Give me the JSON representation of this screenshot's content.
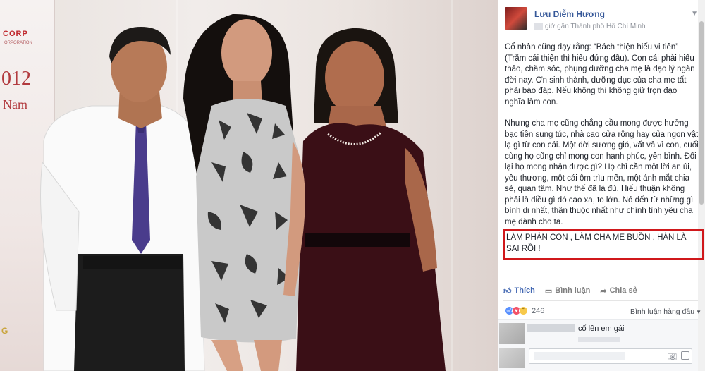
{
  "photo": {
    "banner_corp": "CORP",
    "banner_sub": "ORPORATION",
    "banner_year": "012",
    "banner_name": "Nam",
    "banner_logo": "G"
  },
  "post": {
    "author": "Lưu Diễm Hương",
    "meta": "giờ gần Thành phố Hồ Chí Minh",
    "paragraph1": "Cổ nhân cũng dạy rằng: “Bách thiện hiếu vi tiên” (Trăm cái thiện thì hiếu đứng đầu). Con cái phải hiếu thảo, chăm sóc, phụng dưỡng cha mẹ là đạo lý ngàn đời nay. Ơn sinh thành, dưỡng dục của cha mẹ tất phải báo đáp. Nếu không thì không giữ trọn đạo nghĩa làm con.",
    "paragraph2": "Nhưng cha mẹ cũng chẳng cầu mong được hưởng bạc tiền sung túc, nhà cao cửa rộng hay của ngon vật lạ gì từ con cái. Một đời sương gió, vất vả vì con, cuối cùng họ cũng chỉ mong con hạnh phúc, yên bình. Đổi lại họ mong nhận được gì? Họ chỉ cần một lời an ủi, yêu thương, một cái ôm trìu mến, một ánh mắt chia sẻ, quan tâm. Như thế đã là đủ. Hiếu thuận không phải là điều gì đó cao xa, to lớn. Nó đến từ những gì bình dị nhất, thân thuộc nhất như chính tình yêu cha mẹ dành cho ta.",
    "highlight": "LÀM PHẬN CON , LÀM CHA MẸ BUỒN , HẲN LÀ SAI RỒI !"
  },
  "actions": {
    "like": "Thích",
    "comment": "Bình luận",
    "share": "Chia sẻ"
  },
  "reactions": {
    "count": "246",
    "sort_label": "Bình luận hàng đầu"
  },
  "comments": {
    "first_text": "cố lên em gái"
  },
  "colors": {
    "fb_link": "#365899",
    "like_blue": "#4267b2",
    "highlight_red": "#d0181b"
  }
}
